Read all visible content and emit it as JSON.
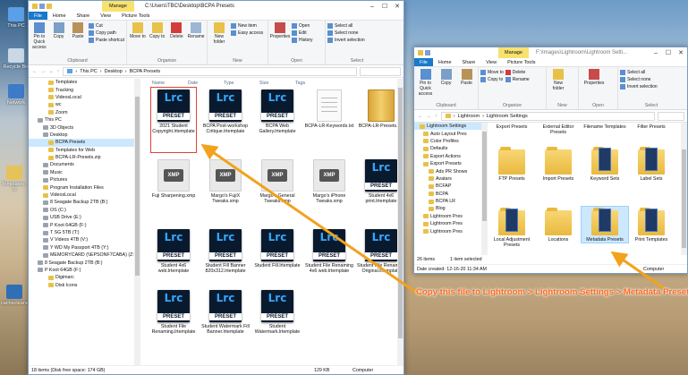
{
  "colors": {
    "accent": "#1979ca",
    "manage": "#f7e26e",
    "annotation": "#ff6a1f",
    "lrc_blue": "#31a8ff",
    "selection": "#cce8ff"
  },
  "desktop_icons": [
    {
      "label": "This PC"
    },
    {
      "label": "Recycle Bin"
    },
    {
      "label": "Network"
    },
    {
      "label": "Templates - S"
    },
    {
      "label": "cachecleaner"
    }
  ],
  "left_window": {
    "manage_tab": "Manage",
    "title_path": "C:\\Users\\TBC\\Desktop\\BCPA Presets",
    "ribbon_tabs": [
      "File",
      "Home",
      "Share",
      "View",
      "Picture Tools"
    ],
    "ribbon": {
      "clipboard": {
        "pin": "Pin to Quick access",
        "copy": "Copy",
        "paste": "Paste",
        "cut": "Cut",
        "copy_path": "Copy path",
        "paste_shortcut": "Paste shortcut",
        "group": "Clipboard"
      },
      "organize": {
        "move_to": "Move to",
        "copy_to": "Copy to",
        "delete": "Delete",
        "rename": "Rename",
        "group": "Organize"
      },
      "new": {
        "new_folder": "New folder",
        "new_item": "New item",
        "easy_access": "Easy access",
        "group": "New"
      },
      "open": {
        "properties": "Properties",
        "open": "Open",
        "edit": "Edit",
        "history": "History",
        "group": "Open"
      },
      "select": {
        "select_all": "Select all",
        "select_none": "Select none",
        "invert": "Invert selection",
        "group": "Select"
      }
    },
    "breadcrumb": [
      "This PC",
      "Desktop",
      "BCPA Presets"
    ],
    "columns": [
      "Name",
      "Date",
      "Type",
      "Size",
      "Tags"
    ],
    "nav_items": [
      {
        "label": "Templates",
        "icon": "folder"
      },
      {
        "label": "Tracking",
        "icon": "folder"
      },
      {
        "label": "VideosLocal",
        "icon": "folder"
      },
      {
        "label": "wc",
        "icon": "folder"
      },
      {
        "label": "Zoom",
        "icon": "folder"
      },
      {
        "label": "This PC",
        "icon": "pc"
      },
      {
        "label": "3D Objects",
        "icon": "drive"
      },
      {
        "label": "Desktop",
        "icon": "drive"
      },
      {
        "label": "BCPA Presets",
        "icon": "folder",
        "selected": true
      },
      {
        "label": "Templates for Web",
        "icon": "folder"
      },
      {
        "label": "BCPA-LR-Presets.zip",
        "icon": "folder"
      },
      {
        "label": "Documents",
        "icon": "drive"
      },
      {
        "label": "Music",
        "icon": "drive"
      },
      {
        "label": "Pictures",
        "icon": "drive"
      },
      {
        "label": "Program Installation Files",
        "icon": "folder"
      },
      {
        "label": "VideosLocal",
        "icon": "folder"
      },
      {
        "label": "8 Seagate Backup 2TB (B:)",
        "icon": "drive"
      },
      {
        "label": "OS (C:)",
        "icon": "drive"
      },
      {
        "label": "USB Drive (E:)",
        "icon": "drive"
      },
      {
        "label": "P Koot 64GB (F:)",
        "icon": "drive"
      },
      {
        "label": "T SG 5TB (T:)",
        "icon": "drive"
      },
      {
        "label": "V Videos 4TB (V:)",
        "icon": "drive"
      },
      {
        "label": "Y WD My Passport 4TB (Y:)",
        "icon": "drive"
      },
      {
        "label": "MEMORYCARD (\\\\EPSONF7CABA) (Z:)",
        "icon": "drive"
      },
      {
        "label": "8 Seagate Backup 2TB (B:)",
        "icon": "drive"
      },
      {
        "label": "P Koot 64GB (F:)",
        "icon": "drive"
      },
      {
        "label": "Digimarc",
        "icon": "folder"
      },
      {
        "label": "Disk Icons",
        "icon": "folder"
      }
    ],
    "files": [
      {
        "name": "2021 Student Copyright.lrtemplate",
        "kind": "lrc",
        "selected": true
      },
      {
        "name": "BCPA Post-workshop Critique.lrtemplate",
        "kind": "lrc"
      },
      {
        "name": "BCPA Web Gallery.lrtemplate",
        "kind": "lrc"
      },
      {
        "name": "BCPA-LR-Keywords.txt",
        "kind": "txt"
      },
      {
        "name": "BCPA-LR-Presets.zip",
        "kind": "zip"
      },
      {
        "name": "Fuji Sharpening.xmp",
        "kind": "xmp"
      },
      {
        "name": "Margo's FujiX Tweaks.xmp",
        "kind": "xmp"
      },
      {
        "name": "Margo's General Tweaks.xmp",
        "kind": "xmp"
      },
      {
        "name": "Margo's iPhone Tweaks.xmp",
        "kind": "xmp"
      },
      {
        "name": "Student 4x6 print.lrtemplate",
        "kind": "lrc"
      },
      {
        "name": "Student 4x6 web.lrtemplate",
        "kind": "lrc"
      },
      {
        "name": "Student Fill Banner 820x312.lrtemplate",
        "kind": "lrc"
      },
      {
        "name": "Student Fill.lrtemplate",
        "kind": "lrc"
      },
      {
        "name": "Student File Renaming 4x6 web.lrtemplate",
        "kind": "lrc"
      },
      {
        "name": "Student File Renaming Original.lrtemplate",
        "kind": "lrc"
      },
      {
        "name": "Student File Renaming.lrtemplate",
        "kind": "lrc"
      },
      {
        "name": "Student Watermark Fill Banner.lrtemplate",
        "kind": "lrc"
      },
      {
        "name": "Student Watermark.lrtemplate",
        "kind": "lrc"
      }
    ],
    "status_left": "18 items (Disk free space: 174 GB)",
    "status_size": "129 KB",
    "status_right": "Computer"
  },
  "right_window": {
    "manage_tab": "Manage",
    "title_path": "F:\\Images\\Lightroom\\Lightroom Setti...",
    "ribbon_tabs": [
      "File",
      "Home",
      "Share",
      "View",
      "Picture Tools"
    ],
    "ribbon": {
      "pin": "Pin to Quick access",
      "copy": "Copy",
      "paste": "Paste",
      "move_to": "Move to",
      "copy_to": "Copy to",
      "delete": "Delete",
      "rename": "Rename",
      "new_folder": "New folder",
      "properties": "Properties",
      "select_all": "Select all",
      "select_none": "Select none",
      "invert": "Invert selection",
      "g_clipboard": "Clipboard",
      "g_organize": "Organize",
      "g_new": "New",
      "g_open": "Open",
      "g_select": "Select"
    },
    "breadcrumb": [
      "Lightroom",
      "Lightroom Settings"
    ],
    "nav_items": [
      {
        "label": "Lightroom Settings",
        "selected": true
      },
      {
        "label": "Auto Layout Pres"
      },
      {
        "label": "Color Profiles"
      },
      {
        "label": "Defaults"
      },
      {
        "label": "Export Actions"
      },
      {
        "label": "Export Presets"
      },
      {
        "label": "Ads PR Shows"
      },
      {
        "label": "Avatars"
      },
      {
        "label": "BCFAP"
      },
      {
        "label": "BCPA"
      },
      {
        "label": "BCPA LR"
      },
      {
        "label": "Blog"
      },
      {
        "label": "Lightroom Pres"
      },
      {
        "label": "Lightroom Pres"
      },
      {
        "label": "Lightroom Pres"
      }
    ],
    "top_row_labels": [
      "Export Presets",
      "External Editor Presets",
      "Filename Templates",
      "Filter Presets"
    ],
    "folders": [
      {
        "name": "FTP Presets",
        "kind": "plain"
      },
      {
        "name": "Import Presets",
        "kind": "plain"
      },
      {
        "name": "Keyword Sets",
        "kind": "book"
      },
      {
        "name": "Label Sets",
        "kind": "book"
      },
      {
        "name": "Local Adjustment Presets",
        "kind": "book"
      },
      {
        "name": "Locations",
        "kind": "plain"
      },
      {
        "name": "Metadata Presets",
        "kind": "book",
        "selected": true
      },
      {
        "name": "Print Templates",
        "kind": "book"
      }
    ],
    "status_left": "26 items",
    "status_sel": "1 item selected",
    "date_created": "Date created: 12-16-20 11:34 AM",
    "status_right": "Computer"
  },
  "annotation": "Copy this file to Lightroom > Lightroom Settings > Metadata Presets"
}
